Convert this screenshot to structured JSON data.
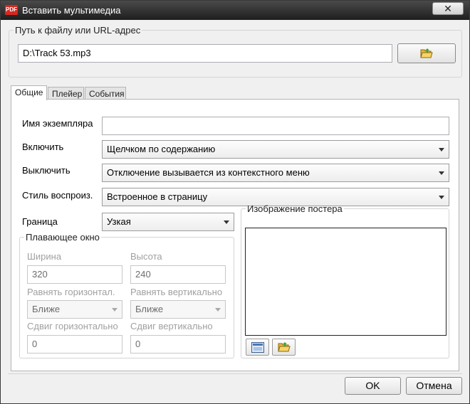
{
  "window": {
    "title": "Вставить мультимедиа",
    "close_label": "✕"
  },
  "path_group": {
    "legend": "Путь к файлу или URL-адрес",
    "value": "D:\\Track 53.mp3",
    "browse_icon": "folder-open-icon"
  },
  "tabs": [
    {
      "label": "Общие",
      "active": true
    },
    {
      "label": "Плейер",
      "active": false
    },
    {
      "label": "События",
      "active": false
    }
  ],
  "general": {
    "instance_name_label": "Имя экземпляра",
    "instance_name_value": "",
    "enable_label": "Включить",
    "enable_value": "Щелчком по содержанию",
    "disable_label": "Выключить",
    "disable_value": "Отключение вызывается из контекстного меню",
    "style_label": "Стиль воспроиз.",
    "style_value": "Встроенное в страницу",
    "border_label": "Граница",
    "border_value": "Узкая"
  },
  "floating": {
    "legend": "Плавающее окно",
    "width_label": "Ширина",
    "width_value": "320",
    "height_label": "Высота",
    "height_value": "240",
    "halign_label": "Равнять горизонтал.",
    "halign_value": "Ближе",
    "valign_label": "Равнять вертикально",
    "valign_value": "Ближе",
    "hoffset_label": "Сдвиг горизонтально",
    "hoffset_value": "0",
    "voffset_label": "Сдвиг вертикально",
    "voffset_value": "0"
  },
  "poster": {
    "legend": "Изображение постера"
  },
  "footer": {
    "ok_label": "OK",
    "cancel_label": "Отмена"
  }
}
